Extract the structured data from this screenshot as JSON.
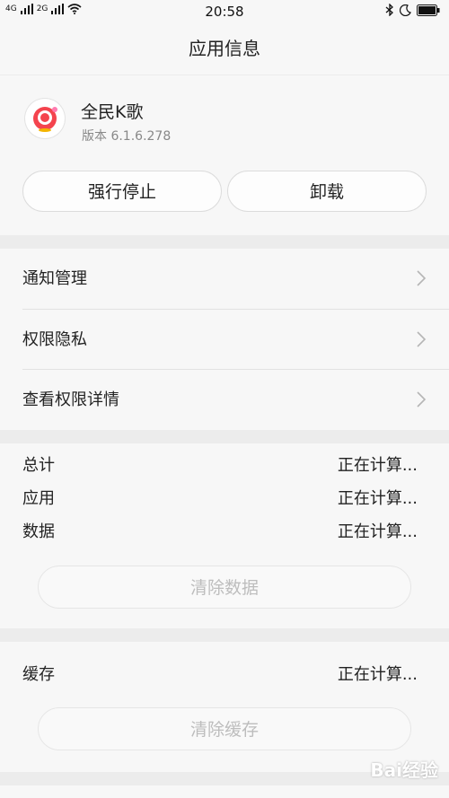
{
  "statusbar": {
    "time": "20:58",
    "sim1": "4G",
    "sim2": "2G",
    "icons": [
      "signal-icon",
      "wifi-icon",
      "bluetooth-icon",
      "moon-icon",
      "battery-icon"
    ]
  },
  "header": {
    "title": "应用信息"
  },
  "app": {
    "name": "全民K歌",
    "version": "版本 6.1.6.278",
    "force_stop_label": "强行停止",
    "uninstall_label": "卸载"
  },
  "menu": {
    "items": [
      {
        "label": "通知管理"
      },
      {
        "label": "权限隐私"
      },
      {
        "label": "查看权限详情"
      }
    ]
  },
  "storage": {
    "rows": [
      {
        "label": "总计",
        "value": "正在计算..."
      },
      {
        "label": "应用",
        "value": "正在计算..."
      },
      {
        "label": "数据",
        "value": "正在计算..."
      }
    ],
    "clear_data_label": "清除数据"
  },
  "cache": {
    "label": "缓存",
    "value": "正在计算...",
    "clear_cache_label": "清除缓存"
  },
  "watermark": "Bai经验",
  "colors": {
    "background": "#ececec",
    "card": "#f7f7f7",
    "disabled_text": "#bdbdbd"
  }
}
